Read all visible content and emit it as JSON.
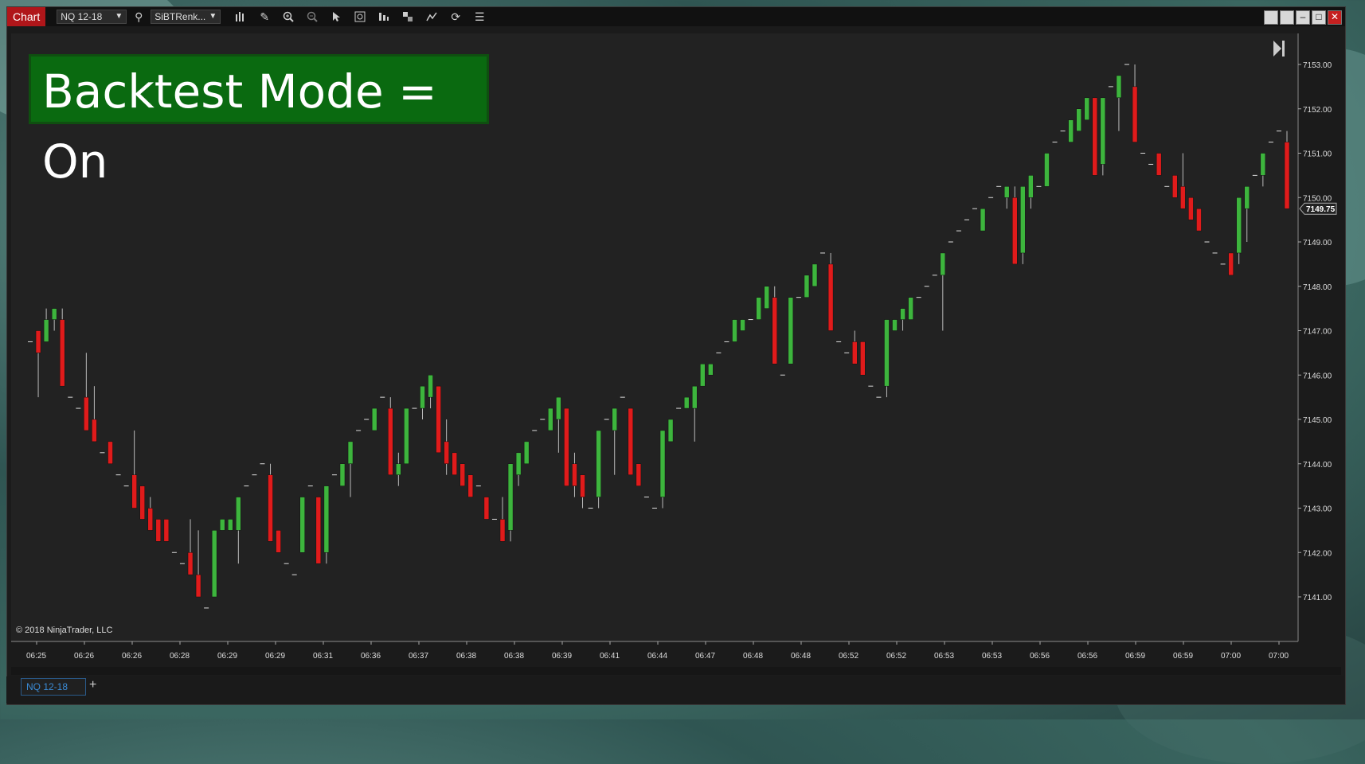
{
  "window": {
    "title_tab": "Chart",
    "instrument_select": "NQ 12-18",
    "bartype_select": "SiBTRenk...",
    "instrument_tab": "NQ 12-18",
    "add_tab_label": "+"
  },
  "overlay": {
    "banner": "Backtest Mode = On"
  },
  "footer": {
    "copyright": "© 2018 NinjaTrader, LLC"
  },
  "colors": {
    "up": "#3db53d",
    "down": "#e01b1b",
    "background": "#222222",
    "banner": "#0a6a10"
  },
  "icons": [
    "search-icon",
    "bar-chart-icon",
    "pencil-icon",
    "zoom-in-icon",
    "zoom-out-icon",
    "pointer-icon",
    "data-box-icon",
    "bars-icon",
    "strategy-icon",
    "indicator-icon",
    "refresh-icon",
    "list-icon"
  ],
  "chart_data": {
    "type": "candlestick",
    "title": "",
    "price_ticks": [
      "7153.00",
      "7152.00",
      "7151.00",
      "7150.00",
      "7149.00",
      "7148.00",
      "7147.00",
      "7146.00",
      "7145.00",
      "7144.00",
      "7143.00",
      "7142.00",
      "7141.00"
    ],
    "current_price": "7149.75",
    "time_ticks": [
      "06:25",
      "06:26",
      "06:26",
      "06:28",
      "06:29",
      "06:29",
      "06:31",
      "06:36",
      "06:37",
      "06:38",
      "06:38",
      "06:39",
      "06:41",
      "06:44",
      "06:47",
      "06:48",
      "06:48",
      "06:52",
      "06:52",
      "06:53",
      "06:53",
      "06:56",
      "06:56",
      "06:59",
      "06:59",
      "07:00",
      "07:00"
    ],
    "ylim": [
      7140.25,
      7153.25
    ],
    "bars": [
      [
        7146.75,
        7146.75,
        7146.75,
        7146.75
      ],
      [
        7147.0,
        7147.0,
        7145.5,
        7146.5
      ],
      [
        7146.75,
        7147.5,
        7146.75,
        7147.25
      ],
      [
        7147.25,
        7147.5,
        7147.0,
        7147.5
      ],
      [
        7147.25,
        7147.5,
        7145.75,
        7145.75
      ],
      [
        7145.5,
        7145.5,
        7145.5,
        7145.5
      ],
      [
        7145.25,
        7145.25,
        7145.25,
        7145.25
      ],
      [
        7145.5,
        7146.5,
        7144.75,
        7144.75
      ],
      [
        7145.0,
        7145.75,
        7144.5,
        7144.5
      ],
      [
        7144.25,
        7144.25,
        7144.25,
        7144.25
      ],
      [
        7144.5,
        7144.5,
        7144.0,
        7144.0
      ],
      [
        7143.75,
        7143.75,
        7143.75,
        7143.75
      ],
      [
        7143.5,
        7143.5,
        7143.5,
        7143.5
      ],
      [
        7143.75,
        7144.75,
        7143.0,
        7143.0
      ],
      [
        7143.5,
        7143.5,
        7142.75,
        7142.75
      ],
      [
        7143.0,
        7143.25,
        7142.5,
        7142.5
      ],
      [
        7142.75,
        7142.75,
        7142.25,
        7142.25
      ],
      [
        7142.75,
        7142.75,
        7142.25,
        7142.25
      ],
      [
        7142.0,
        7142.0,
        7142.0,
        7142.0
      ],
      [
        7141.75,
        7141.75,
        7141.75,
        7141.75
      ],
      [
        7142.0,
        7142.75,
        7141.5,
        7141.5
      ],
      [
        7141.5,
        7142.5,
        7141.0,
        7141.0
      ],
      [
        7140.75,
        7140.75,
        7140.75,
        7140.75
      ],
      [
        7141.0,
        7142.5,
        7141.0,
        7142.5
      ],
      [
        7142.5,
        7142.75,
        7142.5,
        7142.75
      ],
      [
        7142.5,
        7142.75,
        7142.5,
        7142.75
      ],
      [
        7142.5,
        7143.25,
        7141.75,
        7143.25
      ],
      [
        7143.5,
        7143.5,
        7143.5,
        7143.5
      ],
      [
        7143.75,
        7143.75,
        7143.75,
        7143.75
      ],
      [
        7144.0,
        7144.0,
        7144.0,
        7144.0
      ],
      [
        7143.75,
        7144.0,
        7142.25,
        7142.25
      ],
      [
        7142.5,
        7142.5,
        7142.0,
        7142.0
      ],
      [
        7141.75,
        7141.75,
        7141.75,
        7141.75
      ],
      [
        7141.5,
        7141.5,
        7141.5,
        7141.5
      ],
      [
        7142.0,
        7143.25,
        7142.0,
        7143.25
      ],
      [
        7143.5,
        7143.5,
        7143.5,
        7143.5
      ],
      [
        7143.25,
        7143.25,
        7141.75,
        7141.75
      ],
      [
        7142.0,
        7143.5,
        7141.75,
        7143.5
      ],
      [
        7143.75,
        7143.75,
        7143.75,
        7143.75
      ],
      [
        7143.5,
        7144.0,
        7143.5,
        7144.0
      ],
      [
        7144.0,
        7144.5,
        7143.25,
        7144.5
      ],
      [
        7144.75,
        7144.75,
        7144.75,
        7144.75
      ],
      [
        7145.0,
        7145.0,
        7145.0,
        7145.0
      ],
      [
        7144.75,
        7145.25,
        7144.75,
        7145.25
      ],
      [
        7145.5,
        7145.5,
        7145.5,
        7145.5
      ],
      [
        7145.25,
        7145.5,
        7143.75,
        7143.75
      ],
      [
        7143.75,
        7144.25,
        7143.5,
        7144.0
      ],
      [
        7144.0,
        7145.25,
        7144.0,
        7145.25
      ],
      [
        7145.25,
        7145.25,
        7145.25,
        7145.25
      ],
      [
        7145.25,
        7145.75,
        7145.0,
        7145.75
      ],
      [
        7145.5,
        7146.0,
        7145.25,
        7146.0
      ],
      [
        7145.75,
        7145.75,
        7144.25,
        7144.25
      ],
      [
        7144.5,
        7145.0,
        7143.75,
        7144.0
      ],
      [
        7144.25,
        7144.25,
        7143.75,
        7143.75
      ],
      [
        7144.0,
        7144.0,
        7143.5,
        7143.5
      ],
      [
        7143.75,
        7143.75,
        7143.25,
        7143.25
      ],
      [
        7143.5,
        7143.5,
        7143.5,
        7143.5
      ],
      [
        7143.25,
        7143.25,
        7142.75,
        7142.75
      ],
      [
        7142.75,
        7142.75,
        7142.75,
        7142.75
      ],
      [
        7142.75,
        7143.25,
        7142.25,
        7142.25
      ],
      [
        7142.5,
        7144.0,
        7142.25,
        7144.0
      ],
      [
        7143.75,
        7144.25,
        7143.5,
        7144.25
      ],
      [
        7144.0,
        7144.5,
        7144.0,
        7144.5
      ],
      [
        7144.75,
        7144.75,
        7144.75,
        7144.75
      ],
      [
        7145.0,
        7145.0,
        7145.0,
        7145.0
      ],
      [
        7144.75,
        7145.25,
        7144.75,
        7145.25
      ],
      [
        7145.0,
        7145.5,
        7144.25,
        7145.5
      ],
      [
        7145.25,
        7145.25,
        7143.5,
        7143.5
      ],
      [
        7144.0,
        7144.25,
        7143.25,
        7143.5
      ],
      [
        7143.75,
        7143.75,
        7143.0,
        7143.25
      ],
      [
        7143.0,
        7143.0,
        7143.0,
        7143.0
      ],
      [
        7143.25,
        7144.75,
        7143.0,
        7144.75
      ],
      [
        7145.0,
        7145.0,
        7145.0,
        7145.0
      ],
      [
        7144.75,
        7145.25,
        7143.75,
        7145.25
      ],
      [
        7145.5,
        7145.5,
        7145.5,
        7145.5
      ],
      [
        7145.25,
        7145.25,
        7143.75,
        7143.75
      ],
      [
        7144.0,
        7144.0,
        7143.5,
        7143.5
      ],
      [
        7143.25,
        7143.25,
        7143.25,
        7143.25
      ],
      [
        7143.0,
        7143.0,
        7143.0,
        7143.0
      ],
      [
        7143.25,
        7144.75,
        7143.0,
        7144.75
      ],
      [
        7144.5,
        7145.0,
        7144.5,
        7145.0
      ],
      [
        7145.25,
        7145.25,
        7145.25,
        7145.25
      ],
      [
        7145.25,
        7145.5,
        7145.25,
        7145.5
      ],
      [
        7145.25,
        7145.75,
        7144.5,
        7145.75
      ],
      [
        7145.75,
        7146.25,
        7145.75,
        7146.25
      ],
      [
        7146.0,
        7146.25,
        7146.0,
        7146.25
      ],
      [
        7146.5,
        7146.5,
        7146.5,
        7146.5
      ],
      [
        7146.75,
        7146.75,
        7146.75,
        7146.75
      ],
      [
        7146.75,
        7147.25,
        7146.75,
        7147.25
      ],
      [
        7147.0,
        7147.25,
        7147.0,
        7147.25
      ],
      [
        7147.25,
        7147.25,
        7147.25,
        7147.25
      ],
      [
        7147.25,
        7147.75,
        7147.25,
        7147.75
      ],
      [
        7147.5,
        7148.0,
        7147.5,
        7148.0
      ],
      [
        7147.75,
        7148.0,
        7146.25,
        7146.25
      ],
      [
        7146.0,
        7146.0,
        7146.0,
        7146.0
      ],
      [
        7146.25,
        7147.75,
        7146.25,
        7147.75
      ],
      [
        7147.75,
        7147.75,
        7147.75,
        7147.75
      ],
      [
        7147.75,
        7148.25,
        7147.75,
        7148.25
      ],
      [
        7148.0,
        7148.5,
        7148.0,
        7148.5
      ],
      [
        7148.75,
        7148.75,
        7148.75,
        7148.75
      ],
      [
        7148.5,
        7148.75,
        7147.0,
        7147.0
      ],
      [
        7146.75,
        7146.75,
        7146.75,
        7146.75
      ],
      [
        7146.5,
        7146.5,
        7146.5,
        7146.5
      ],
      [
        7146.75,
        7147.0,
        7146.25,
        7146.25
      ],
      [
        7146.75,
        7146.75,
        7146.0,
        7146.0
      ],
      [
        7145.75,
        7145.75,
        7145.75,
        7145.75
      ],
      [
        7145.5,
        7145.5,
        7145.5,
        7145.5
      ],
      [
        7145.75,
        7147.25,
        7145.5,
        7147.25
      ],
      [
        7147.0,
        7147.25,
        7147.0,
        7147.25
      ],
      [
        7147.25,
        7147.5,
        7147.0,
        7147.5
      ],
      [
        7147.25,
        7147.75,
        7147.25,
        7147.75
      ],
      [
        7147.75,
        7147.75,
        7147.75,
        7147.75
      ],
      [
        7148.0,
        7148.0,
        7148.0,
        7148.0
      ],
      [
        7148.25,
        7148.25,
        7148.25,
        7148.25
      ],
      [
        7148.25,
        7148.75,
        7147.0,
        7148.75
      ],
      [
        7149.0,
        7149.0,
        7149.0,
        7149.0
      ],
      [
        7149.25,
        7149.25,
        7149.25,
        7149.25
      ],
      [
        7149.5,
        7149.5,
        7149.5,
        7149.5
      ],
      [
        7149.75,
        7149.75,
        7149.75,
        7149.75
      ],
      [
        7149.25,
        7149.75,
        7149.25,
        7149.75
      ],
      [
        7150.0,
        7150.0,
        7150.0,
        7150.0
      ],
      [
        7150.25,
        7150.25,
        7150.25,
        7150.25
      ],
      [
        7150.0,
        7150.25,
        7149.75,
        7150.25
      ],
      [
        7150.0,
        7150.25,
        7148.5,
        7148.5
      ],
      [
        7148.75,
        7150.25,
        7148.5,
        7150.25
      ],
      [
        7150.0,
        7150.5,
        7149.75,
        7150.5
      ],
      [
        7150.25,
        7150.25,
        7150.25,
        7150.25
      ],
      [
        7150.25,
        7151.0,
        7150.25,
        7151.0
      ],
      [
        7151.25,
        7151.25,
        7151.25,
        7151.25
      ],
      [
        7151.5,
        7151.5,
        7151.5,
        7151.5
      ],
      [
        7151.25,
        7151.75,
        7151.25,
        7151.75
      ],
      [
        7151.5,
        7152.0,
        7151.5,
        7152.0
      ],
      [
        7151.75,
        7152.25,
        7151.75,
        7152.25
      ],
      [
        7152.25,
        7152.25,
        7150.5,
        7150.5
      ],
      [
        7150.75,
        7152.25,
        7150.5,
        7152.25
      ],
      [
        7152.5,
        7152.5,
        7152.5,
        7152.5
      ],
      [
        7152.25,
        7152.75,
        7151.5,
        7152.75
      ],
      [
        7153.0,
        7153.0,
        7153.0,
        7153.0
      ],
      [
        7152.5,
        7153.0,
        7151.25,
        7151.25
      ],
      [
        7151.0,
        7151.0,
        7151.0,
        7151.0
      ],
      [
        7150.75,
        7150.75,
        7150.75,
        7150.75
      ],
      [
        7151.0,
        7151.0,
        7150.5,
        7150.5
      ],
      [
        7150.25,
        7150.25,
        7150.25,
        7150.25
      ],
      [
        7150.5,
        7150.5,
        7150.0,
        7150.0
      ],
      [
        7150.25,
        7151.0,
        7149.75,
        7149.75
      ],
      [
        7150.0,
        7150.0,
        7149.5,
        7149.5
      ],
      [
        7149.75,
        7149.75,
        7149.25,
        7149.25
      ],
      [
        7149.0,
        7149.0,
        7149.0,
        7149.0
      ],
      [
        7148.75,
        7148.75,
        7148.75,
        7148.75
      ],
      [
        7148.5,
        7148.5,
        7148.5,
        7148.5
      ],
      [
        7148.75,
        7148.75,
        7148.25,
        7148.25
      ],
      [
        7148.75,
        7150.0,
        7148.5,
        7150.0
      ],
      [
        7149.75,
        7150.25,
        7149.0,
        7150.25
      ],
      [
        7150.5,
        7150.5,
        7150.5,
        7150.5
      ],
      [
        7150.5,
        7151.0,
        7150.25,
        7151.0
      ],
      [
        7151.25,
        7151.25,
        7151.25,
        7151.25
      ],
      [
        7151.5,
        7151.5,
        7151.5,
        7151.5
      ],
      [
        7151.25,
        7151.5,
        7149.75,
        7149.75
      ]
    ]
  }
}
